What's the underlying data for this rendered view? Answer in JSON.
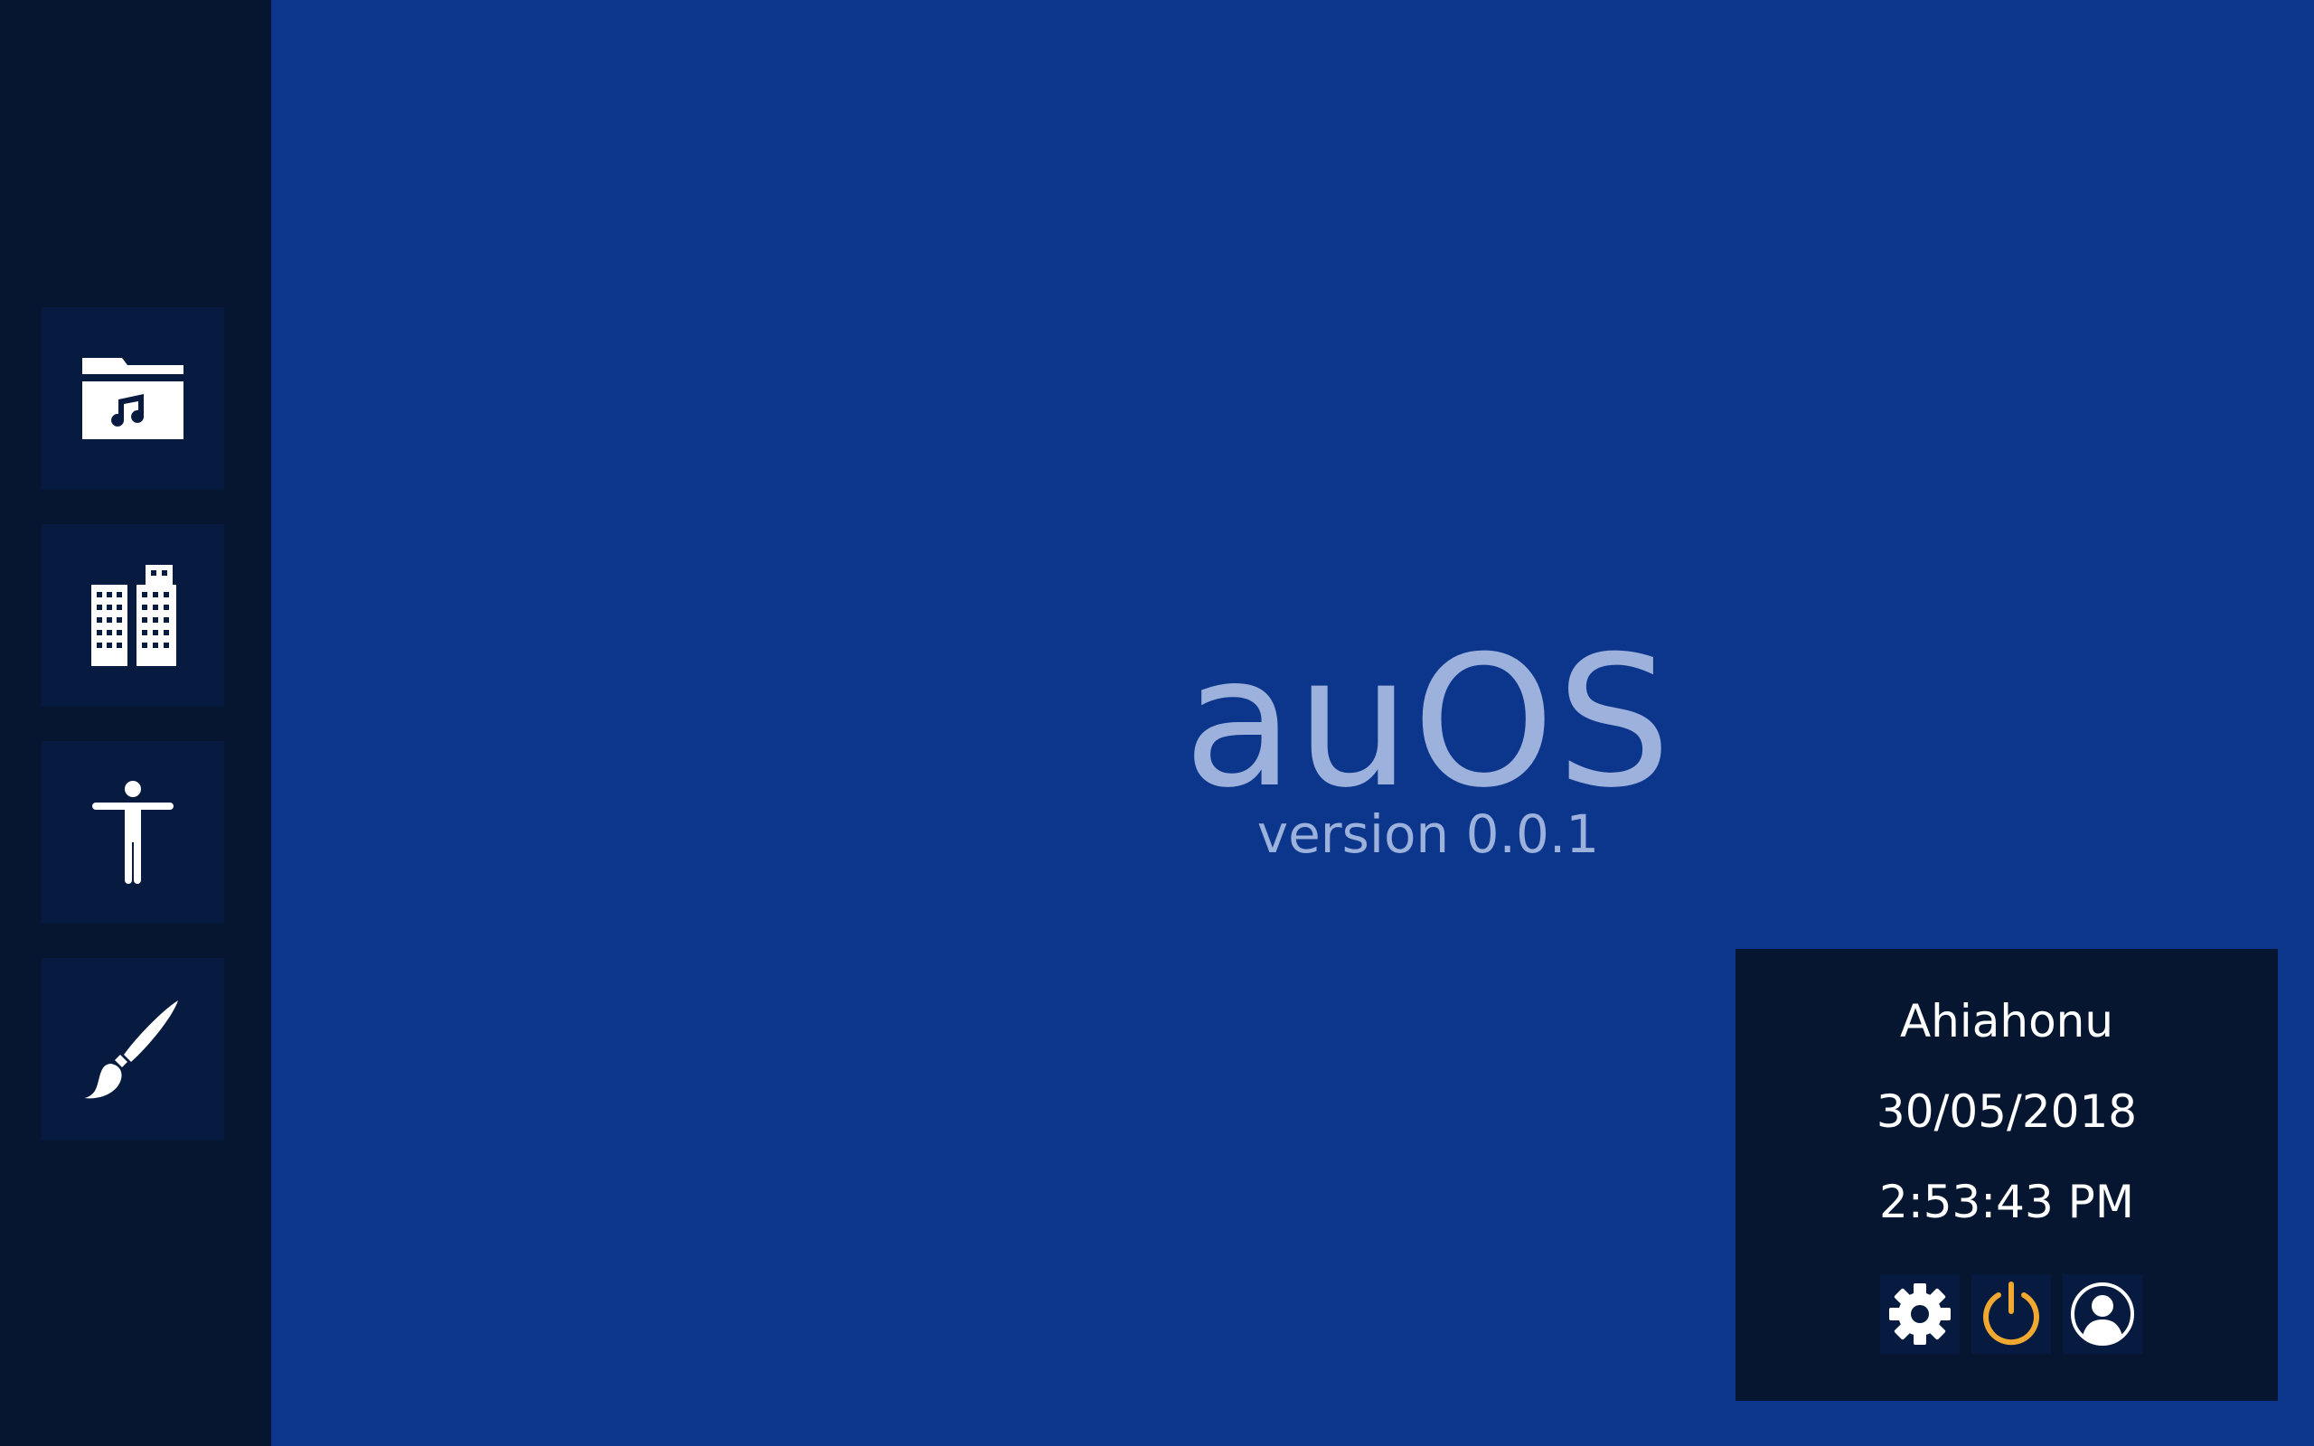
{
  "sidebar": {
    "apps": [
      {
        "icon": "music-folder-icon"
      },
      {
        "icon": "buildings-icon"
      },
      {
        "icon": "accessibility-icon"
      },
      {
        "icon": "paintbrush-icon"
      }
    ]
  },
  "desktop": {
    "title": "auOS",
    "version": "version 0.0.1"
  },
  "info_panel": {
    "username": "Ahiahonu",
    "date": "30/05/2018",
    "time": "2:53:43 PM",
    "buttons": [
      {
        "icon": "gear-icon"
      },
      {
        "icon": "power-icon",
        "color": "#f0a830"
      },
      {
        "icon": "user-account-icon"
      }
    ]
  },
  "colors": {
    "desktop_background": "#0c358c",
    "sidebar_background": "#061631",
    "brand_text": "#9cb1dc",
    "power_accent": "#f0a830"
  }
}
